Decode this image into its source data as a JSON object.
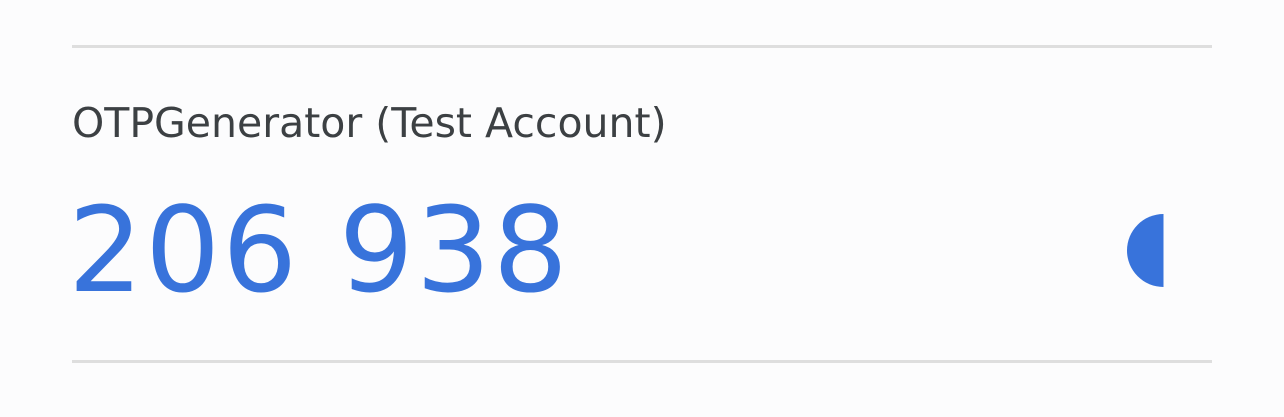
{
  "account": {
    "name": "OTPGenerator (Test Account)",
    "code": "206 938"
  },
  "timer": {
    "icon": "countdown-timer-icon",
    "remaining_fraction": 0.5,
    "color": "#3873db"
  },
  "colors": {
    "accent": "#3873db",
    "text": "#3c4043",
    "divider": "#dedede",
    "background": "#fcfcfd"
  }
}
